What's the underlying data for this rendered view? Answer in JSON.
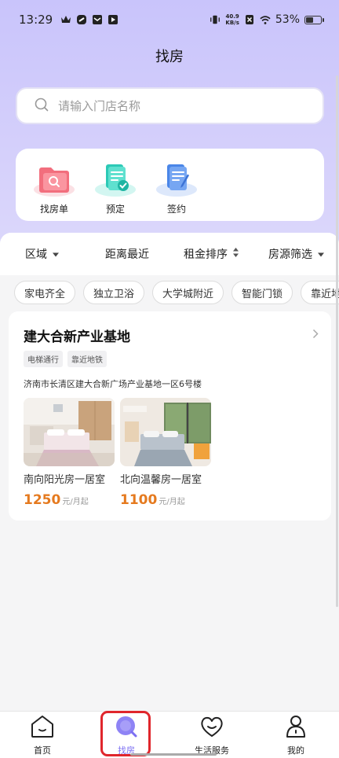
{
  "status_bar": {
    "time": "13:29",
    "net_speed_value": "40.9",
    "net_speed_unit": "KB/s",
    "battery": "53%",
    "battery_level": 0.53
  },
  "header": {
    "title": "找房"
  },
  "search": {
    "placeholder": "请输入门店名称"
  },
  "quick_actions": [
    {
      "label": "找房单",
      "icon": "folder-search-icon"
    },
    {
      "label": "预定",
      "icon": "document-check-icon"
    },
    {
      "label": "签约",
      "icon": "document-sign-icon"
    }
  ],
  "filters": [
    {
      "label": "区域",
      "icon": "caret-down-icon"
    },
    {
      "label": "距离最近"
    },
    {
      "label": "租金排序",
      "icon": "sort-icon"
    },
    {
      "label": "房源筛选",
      "icon": "caret-down-icon"
    }
  ],
  "tags": [
    "家电齐全",
    "独立卫浴",
    "大学城附近",
    "智能门锁",
    "靠近地铁"
  ],
  "store": {
    "name": "建大合新产业基地",
    "tags": [
      "电梯通行",
      "靠近地铁"
    ],
    "address": "济南市长清区建大合新广场产业基地一区6号楼",
    "rooms": [
      {
        "name": "南向阳光房一居室",
        "price": "1250",
        "unit": "元/月起"
      },
      {
        "name": "北向温馨房一居室",
        "price": "1100",
        "unit": "元/月起"
      }
    ]
  },
  "tabbar": [
    {
      "label": "首页",
      "icon": "home-icon",
      "active": false
    },
    {
      "label": "找房",
      "icon": "search-icon",
      "active": true
    },
    {
      "label": "生活服务",
      "icon": "heart-icon",
      "active": false
    },
    {
      "label": "我的",
      "icon": "user-icon",
      "active": false
    }
  ],
  "colors": {
    "accent": "#7c6ff2",
    "price": "#e57a1f",
    "header_bg": "#c9c4fb",
    "highlight": "#e0262c"
  }
}
